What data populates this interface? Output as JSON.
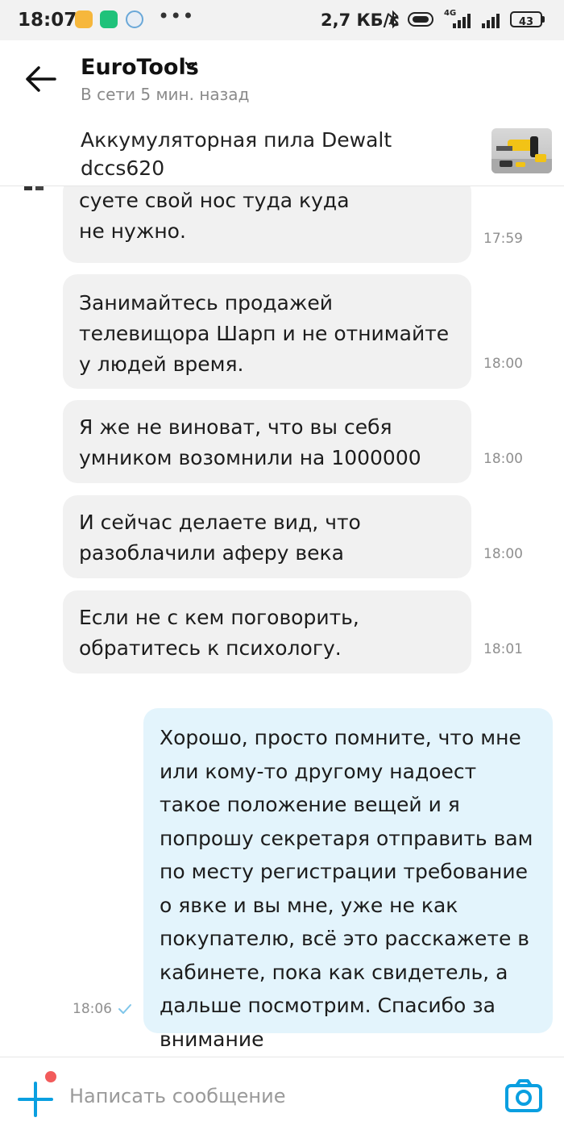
{
  "status_bar": {
    "time": "18:07",
    "network_speed": "2,7 КБ/с",
    "network_type": "4G",
    "battery": "43",
    "icons": [
      "notes-app-icon",
      "shield-app-icon",
      "browser-app-icon",
      "more-dots",
      "bluetooth-icon",
      "toggle-icon",
      "signal-icon",
      "signal-icon",
      "battery-icon"
    ]
  },
  "header": {
    "title": "EuroTools",
    "status": "В сети 5 мин. назад"
  },
  "product": {
    "title": "Аккумуляторная пила Dewalt dccs620"
  },
  "messages": [
    {
      "direction": "incoming",
      "text": "суете свой нос туда куда не нужно.",
      "time": "17:59"
    },
    {
      "direction": "incoming",
      "text": "Занимайтесь продажей телевищора Шарп и не отнимайте у людей время.",
      "time": "18:00"
    },
    {
      "direction": "incoming",
      "text": "Я же не виноват, что вы себя умником возомнили на 1000000",
      "time": "18:00"
    },
    {
      "direction": "incoming",
      "text": "И сейчас делаете вид, что разоблачили аферу века",
      "time": "18:00"
    },
    {
      "direction": "incoming",
      "text": "Если не с кем поговорить, обратитесь к психологу.",
      "time": "18:01"
    },
    {
      "direction": "outgoing",
      "text": "Хорошо, просто помните, что мне или кому-то другому надоест такое положение вещей и я попрошу секретаря отправить вам по месту регистрации требование о явке и вы мне, уже не как покупателю, всё это расскажете в кабинете, пока как свидетель, а дальше посмотрим. Спасибо за внимание",
      "time": "18:06",
      "read": true
    }
  ],
  "composer": {
    "placeholder": "Написать сообщение"
  },
  "colors": {
    "accent": "#0a9fe0",
    "incoming_bubble": "#f1f1f1",
    "outgoing_bubble": "#e3f4fc",
    "notification_dot": "#f25b5b"
  }
}
